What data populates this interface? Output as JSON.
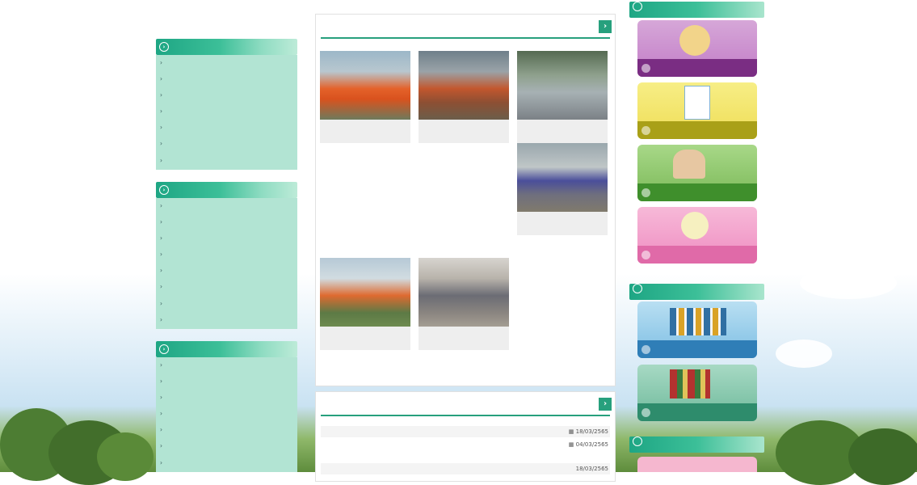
{
  "top_text": "",
  "left_menu": [
    {
      "title": "",
      "items": [
        "",
        "",
        "",
        "",
        "",
        "",
        ""
      ]
    },
    {
      "title": "",
      "items": [
        "",
        "",
        "",
        "",
        "",
        "",
        "",
        "",
        ""
      ]
    },
    {
      "title": "",
      "items": [
        "",
        "",
        "",
        "",
        "",
        "",
        ""
      ]
    }
  ],
  "activities": {
    "title": "",
    "arrow": "›",
    "more": "",
    "items": [
      {
        "caption": ""
      },
      {
        "caption": ""
      },
      {
        "caption": ""
      },
      {
        "caption": ""
      },
      {
        "caption": ""
      },
      {
        "caption": ""
      }
    ]
  },
  "news": {
    "title": "",
    "arrow": "›",
    "items": [
      {
        "text": "",
        "date": "18/03/2565"
      },
      {
        "text": "",
        "date": "04/03/2565"
      },
      {
        "text": "",
        "date": ""
      },
      {
        "text": "",
        "date": "18/03/2565"
      }
    ]
  },
  "right": {
    "top_title": "",
    "complaint_banners": [
      "",
      "",
      "",
      ""
    ],
    "manual_title": "",
    "manual_banners": [
      "",
      ""
    ],
    "law_title": ""
  }
}
